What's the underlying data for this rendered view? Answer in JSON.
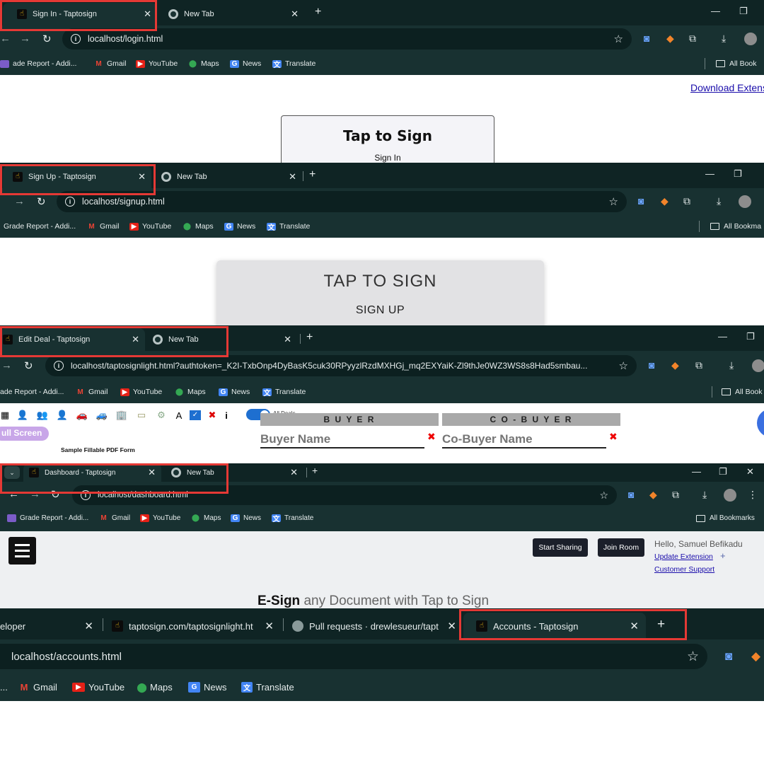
{
  "common": {
    "new_tab": "New Tab",
    "close": "✕",
    "plus": "+",
    "bookmarks": {
      "grade": "Grade Report - Addi...",
      "gmail": "Gmail",
      "youtube": "YouTube",
      "maps": "Maps",
      "news": "News",
      "translate": "Translate",
      "all": "All Bookmarks",
      "all_short": "All Bookmark",
      "all_cut": "All Bookma",
      "all_cut2": "All Book",
      "grade_cut": "ade Report - Addi..."
    }
  },
  "login": {
    "tab_title": "Sign In - Taptosign",
    "url": "localhost/login.html",
    "download_link": "Download Extens",
    "card_title": "Tap to Sign",
    "card_sub": "Sign In"
  },
  "signup": {
    "tab_title": "Sign Up - Taptosign",
    "url": "localhost/signup.html",
    "card_title": "TAP TO SIGN",
    "card_sub": "SIGN UP",
    "grade_cut": "Grade Report - Addi..."
  },
  "editdeal": {
    "tab_title": "Edit Deal - Taptosign",
    "url": "localhost/taptosignlight.html?authtoken=_K2I-TxbOnp4DyBasK5cuk30RPyyzlRzdMXHGj_mq2EXYaiK-Zl9thJe0WZ3WS8s8Had5smbau...",
    "all_deals": "All Deals",
    "fullscreen": "ull Screen",
    "pdf_title": "Sample Fillable PDF Form",
    "buyer_header": "B U Y E R",
    "cobuyer_header": "C O - B U Y E R",
    "buyer_placeholder": "Buyer Name",
    "cobuyer_placeholder": "Co-Buyer Name",
    "toolbar_text_a": "A",
    "toolbar_info": "i"
  },
  "dashboard": {
    "tab_title": "Dashboard - Taptosign",
    "url": "localhost/dashboard.html",
    "start_sharing": "Start Sharing",
    "join_room": "Join Room",
    "greeting": "Hello, Samuel Befikadu",
    "update_extension": "Update Extension",
    "customer_support": "Customer Support",
    "headline_bold": "E-Sign",
    "headline_rest": " any Document with Tap to Sign",
    "plus": "+"
  },
  "accounts": {
    "tab_developer": "eloper",
    "tab_light": "taptosign.com/taptosignlight.ht",
    "tab_pulls": "Pull requests · drewlesueur/tapt",
    "tab_title": "Accounts - Taptosign",
    "url": "localhost/accounts.html"
  },
  "colors": {
    "chrome_bg": "#183131",
    "tabstrip_bg": "#0f2424",
    "highlight": "#e53935",
    "dark_button": "#1b1f2a"
  }
}
